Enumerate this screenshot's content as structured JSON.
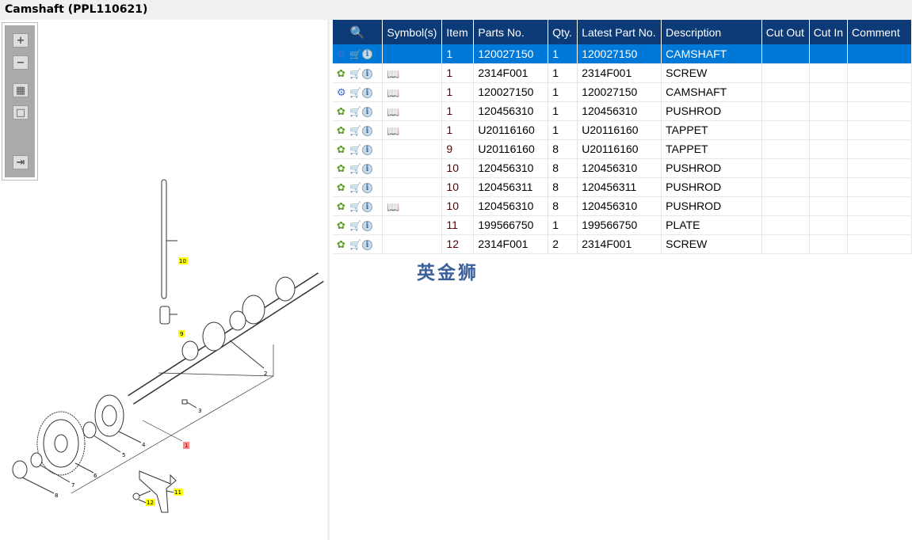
{
  "title": "Camshaft (PPL110621)",
  "toolbar": {
    "zoom_in": "+",
    "zoom_out": "−",
    "fit_all": "▦",
    "fit_page": "□",
    "side_panel": "⇥"
  },
  "columns": [
    "Symbol(s)",
    "Item",
    "Parts No.",
    "Qty.",
    "Latest Part No.",
    "Description",
    "Cut Out",
    "Cut In",
    "Comment"
  ],
  "rows": [
    {
      "item": "1",
      "part": "120027150",
      "qty": "1",
      "latest": "120027150",
      "desc": "CAMSHAFT",
      "book": false,
      "gears": "multi",
      "selected": true
    },
    {
      "item": "1",
      "part": "2314F001",
      "qty": "1",
      "latest": "2314F001",
      "desc": "SCREW",
      "book": true,
      "gears": "single"
    },
    {
      "item": "1",
      "part": "120027150",
      "qty": "1",
      "latest": "120027150",
      "desc": "CAMSHAFT",
      "book": true,
      "gears": "multi"
    },
    {
      "item": "1",
      "part": "120456310",
      "qty": "1",
      "latest": "120456310",
      "desc": "PUSHROD",
      "book": true,
      "gears": "single"
    },
    {
      "item": "1",
      "part": "U20116160",
      "qty": "1",
      "latest": "U20116160",
      "desc": "TAPPET",
      "book": true,
      "gears": "single"
    },
    {
      "item": "9",
      "part": "U20116160",
      "qty": "8",
      "latest": "U20116160",
      "desc": "TAPPET",
      "book": false,
      "gears": "single"
    },
    {
      "item": "10",
      "part": "120456310",
      "qty": "8",
      "latest": "120456310",
      "desc": "PUSHROD",
      "book": false,
      "gears": "single"
    },
    {
      "item": "10",
      "part": "120456311",
      "qty": "8",
      "latest": "120456311",
      "desc": "PUSHROD",
      "book": false,
      "gears": "single"
    },
    {
      "item": "10",
      "part": "120456310",
      "qty": "8",
      "latest": "120456310",
      "desc": "PUSHROD",
      "book": true,
      "gears": "single"
    },
    {
      "item": "11",
      "part": "199566750",
      "qty": "1",
      "latest": "199566750",
      "desc": "PLATE",
      "book": false,
      "gears": "single"
    },
    {
      "item": "12",
      "part": "2314F001",
      "qty": "2",
      "latest": "2314F001",
      "desc": "SCREW",
      "book": false,
      "gears": "single"
    }
  ],
  "watermark": "英金狮",
  "callouts": [
    "1",
    "2",
    "3",
    "4",
    "5",
    "6",
    "7",
    "8",
    "9",
    "10",
    "11",
    "12"
  ],
  "colors": {
    "header": "#0d3b78",
    "selected": "#0078d7",
    "highlight": "#ffff00"
  }
}
